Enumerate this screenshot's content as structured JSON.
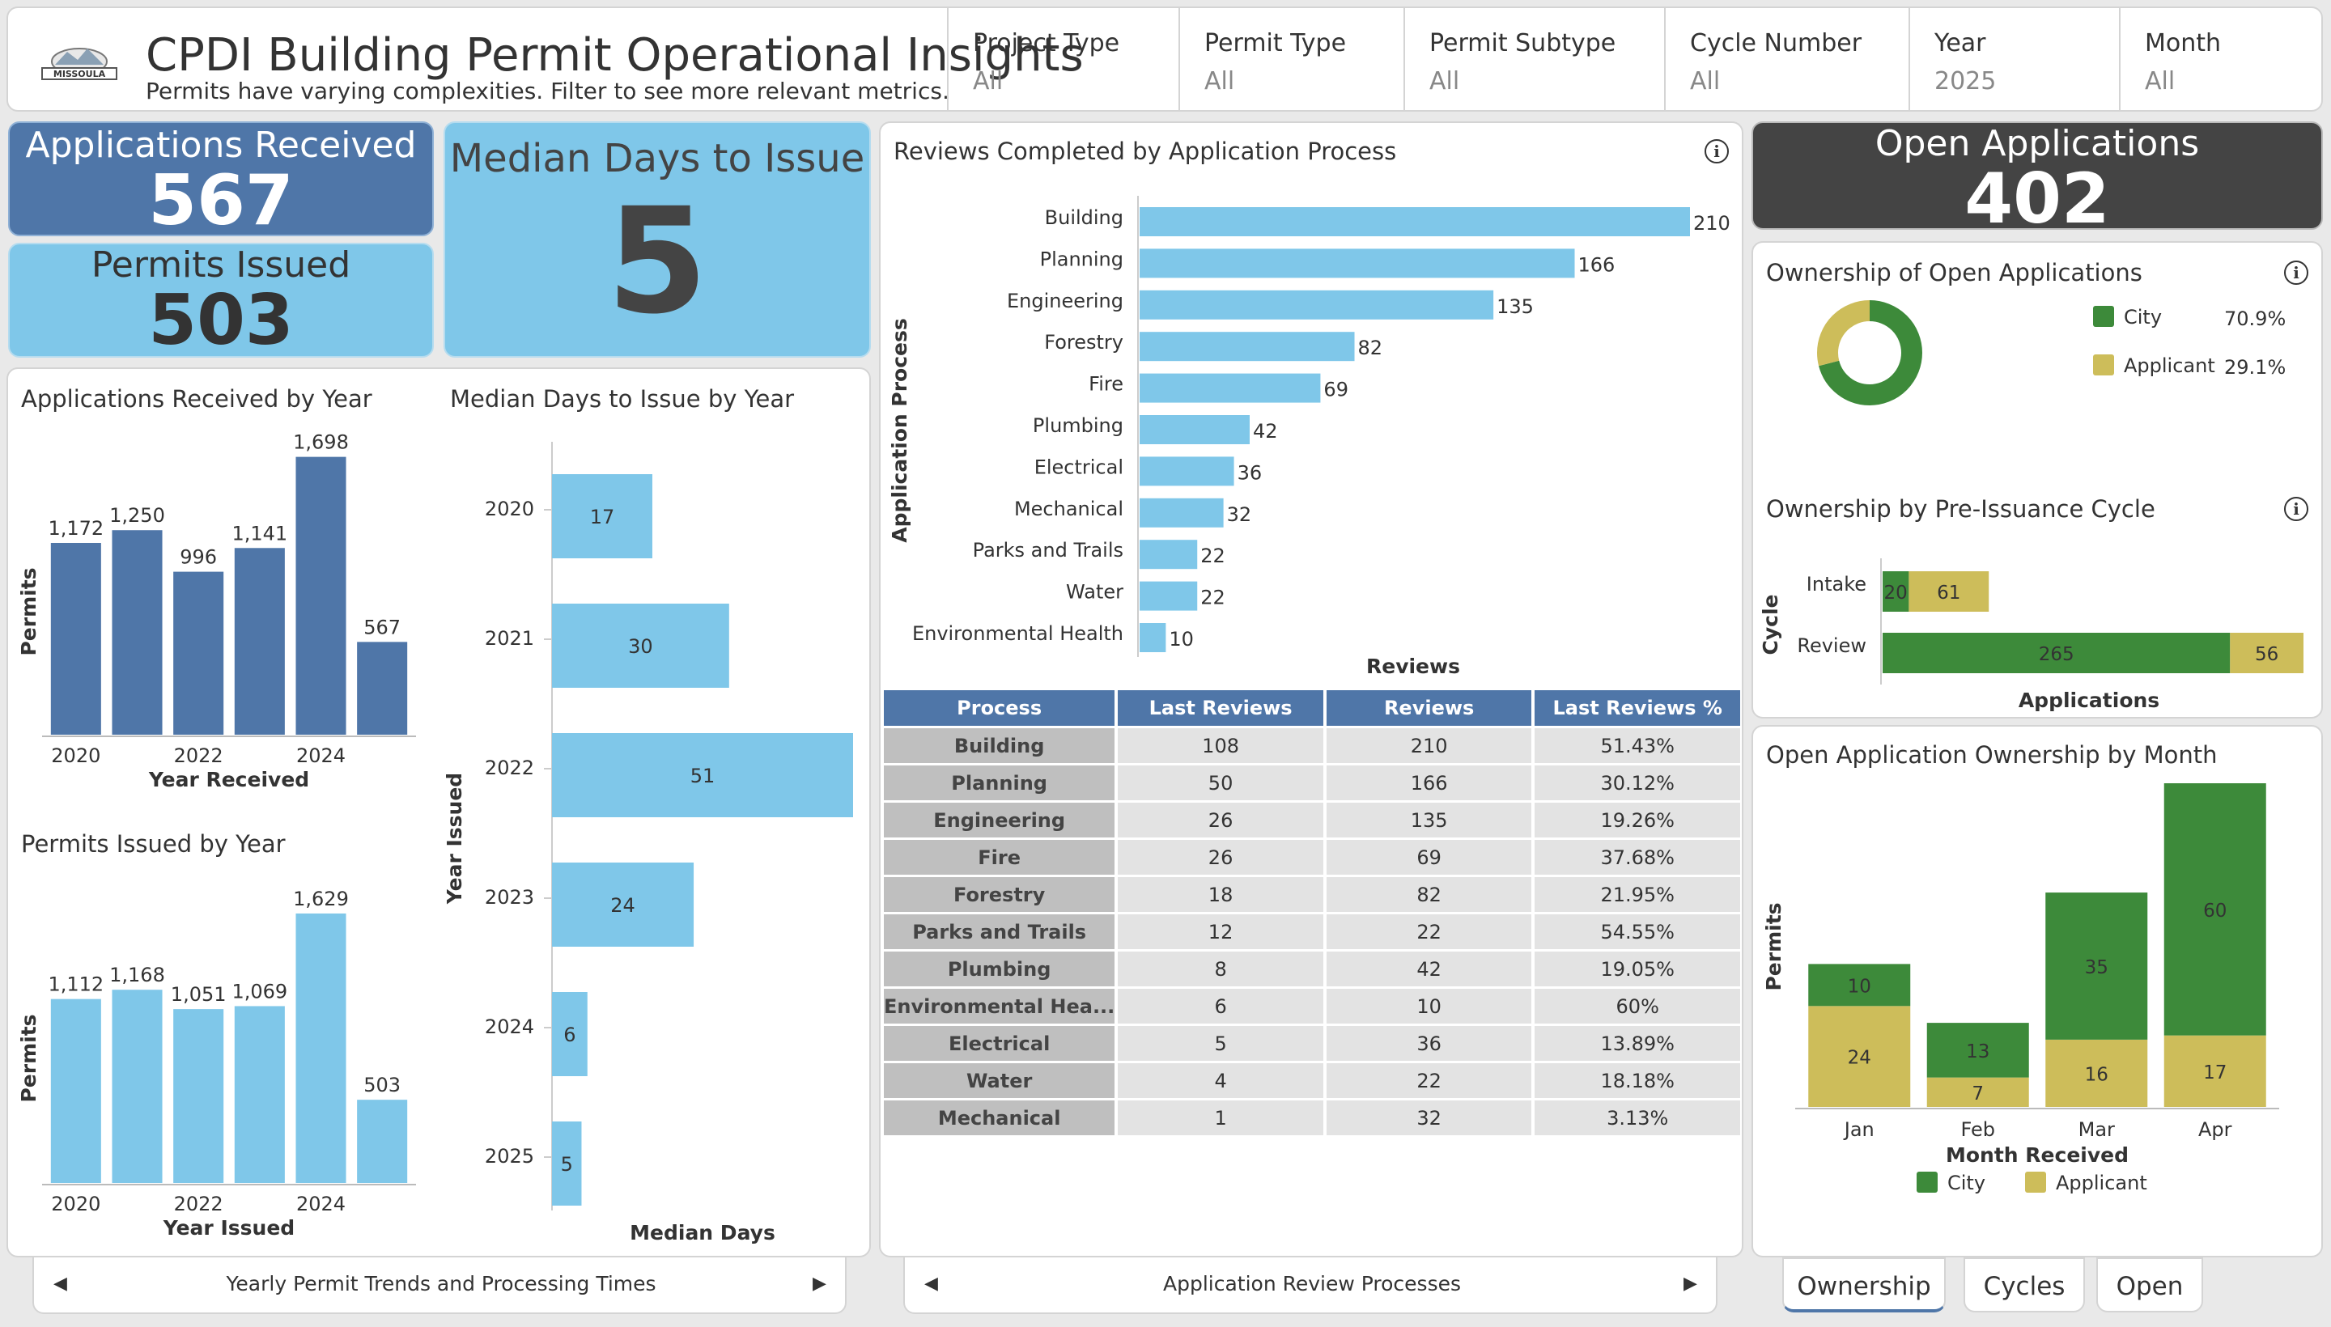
{
  "header": {
    "title": "CPDI Building Permit Operational Insights",
    "subtitle": "Permits have varying complexities. Filter to see more relevant metrics.",
    "logo_text": "MISSOULA"
  },
  "filters": [
    {
      "label": "Project Type",
      "value": "All"
    },
    {
      "label": "Permit Type",
      "value": "All"
    },
    {
      "label": "Permit Subtype",
      "value": "All"
    },
    {
      "label": "Cycle Number",
      "value": "All"
    },
    {
      "label": "Year",
      "value": "2025"
    },
    {
      "label": "Month",
      "value": "All"
    }
  ],
  "kpis": {
    "applications_received": {
      "label": "Applications Received",
      "value": "567"
    },
    "permits_issued": {
      "label": "Permits Issued",
      "value": "503"
    },
    "median_days": {
      "label": "Median Days to Issue",
      "value": "5"
    },
    "open_applications": {
      "label": "Open Applications",
      "value": "402"
    }
  },
  "colors": {
    "dark_blue": "#4f76a8",
    "light_blue": "#7fc7e9",
    "green": "#3d8a3a",
    "gold": "#cdbd5a",
    "dark_gray": "#444444",
    "table_header": "#4f76a8"
  },
  "chart_data": [
    {
      "type": "bar",
      "title": "Applications Received by Year",
      "xlabel": "Year Received",
      "ylabel": "Permits",
      "categories": [
        "2020",
        "2021",
        "2022",
        "2023",
        "2024",
        "2025"
      ],
      "tick_labels": [
        "2020",
        "",
        "2022",
        "",
        "2024",
        ""
      ],
      "values": [
        1172,
        1250,
        996,
        1141,
        1698,
        567
      ],
      "value_labels": [
        "1,172",
        "1,250",
        "996",
        "1,141",
        "1,698",
        "567"
      ],
      "ylim": [
        0,
        1800
      ]
    },
    {
      "type": "bar",
      "title": "Permits Issued by Year",
      "xlabel": "Year Issued",
      "ylabel": "Permits",
      "categories": [
        "2020",
        "2021",
        "2022",
        "2023",
        "2024",
        "2025"
      ],
      "tick_labels": [
        "2020",
        "",
        "2022",
        "",
        "2024",
        ""
      ],
      "values": [
        1112,
        1168,
        1051,
        1069,
        1629,
        503
      ],
      "value_labels": [
        "1,112",
        "1,168",
        "1,051",
        "1,069",
        "1,629",
        "503"
      ],
      "ylim": [
        0,
        1800
      ]
    },
    {
      "type": "bar",
      "title": "Median Days to Issue by Year",
      "xlabel": "Median Days",
      "ylabel": "Year Issued",
      "categories": [
        "2020",
        "2021",
        "2022",
        "2023",
        "2024",
        "2025"
      ],
      "values": [
        17,
        30,
        51,
        24,
        6,
        5
      ],
      "xlim": [
        0,
        51
      ]
    },
    {
      "type": "bar",
      "title": "Reviews Completed by Application Process",
      "xlabel": "Reviews",
      "ylabel": "Application Process",
      "categories": [
        "Building",
        "Planning",
        "Engineering",
        "Forestry",
        "Fire",
        "Plumbing",
        "Electrical",
        "Mechanical",
        "Parks and Trails",
        "Water",
        "Environmental Health"
      ],
      "values": [
        210,
        166,
        135,
        82,
        69,
        42,
        36,
        32,
        22,
        22,
        10
      ],
      "xlim": [
        0,
        210
      ]
    },
    {
      "type": "pie",
      "title": "Ownership of Open Applications",
      "categories": [
        "City",
        "Applicant"
      ],
      "values": [
        70.9,
        29.1
      ],
      "value_labels": [
        "70.9%",
        "29.1%"
      ]
    },
    {
      "type": "bar",
      "title": "Ownership by Pre-Issuance Cycle",
      "xlabel": "Applications",
      "ylabel": "Cycle",
      "categories": [
        "Intake",
        "Review"
      ],
      "series": [
        {
          "name": "City",
          "values": [
            20,
            265
          ]
        },
        {
          "name": "Applicant",
          "values": [
            61,
            56
          ]
        }
      ],
      "xlim": [
        0,
        321
      ]
    },
    {
      "type": "bar",
      "title": "Open Application Ownership by Month",
      "xlabel": "Month Received",
      "ylabel": "Permits",
      "categories": [
        "Jan",
        "Feb",
        "Mar",
        "Apr"
      ],
      "series": [
        {
          "name": "City",
          "values": [
            10,
            13,
            35,
            60
          ]
        },
        {
          "name": "Applicant",
          "values": [
            24,
            7,
            16,
            17
          ]
        }
      ],
      "ylim": [
        0,
        77
      ]
    }
  ],
  "legend": {
    "city": "City",
    "applicant": "Applicant"
  },
  "review_table": {
    "columns": [
      "Process",
      "Last Reviews",
      "Reviews",
      "Last Reviews %"
    ],
    "rows": [
      [
        "Building",
        "108",
        "210",
        "51.43%"
      ],
      [
        "Planning",
        "50",
        "166",
        "30.12%"
      ],
      [
        "Engineering",
        "26",
        "135",
        "19.26%"
      ],
      [
        "Fire",
        "26",
        "69",
        "37.68%"
      ],
      [
        "Forestry",
        "18",
        "82",
        "21.95%"
      ],
      [
        "Parks and Trails",
        "12",
        "22",
        "54.55%"
      ],
      [
        "Plumbing",
        "8",
        "42",
        "19.05%"
      ],
      [
        "Environmental Hea...",
        "6",
        "10",
        "60%"
      ],
      [
        "Electrical",
        "5",
        "36",
        "13.89%"
      ],
      [
        "Water",
        "4",
        "22",
        "18.18%"
      ],
      [
        "Mechanical",
        "1",
        "32",
        "3.13%"
      ]
    ]
  },
  "pagers": {
    "left": "Yearly Permit Trends and Processing Times",
    "middle": "Application Review Processes"
  },
  "tabs": [
    "Ownership",
    "Cycles",
    "Open"
  ]
}
